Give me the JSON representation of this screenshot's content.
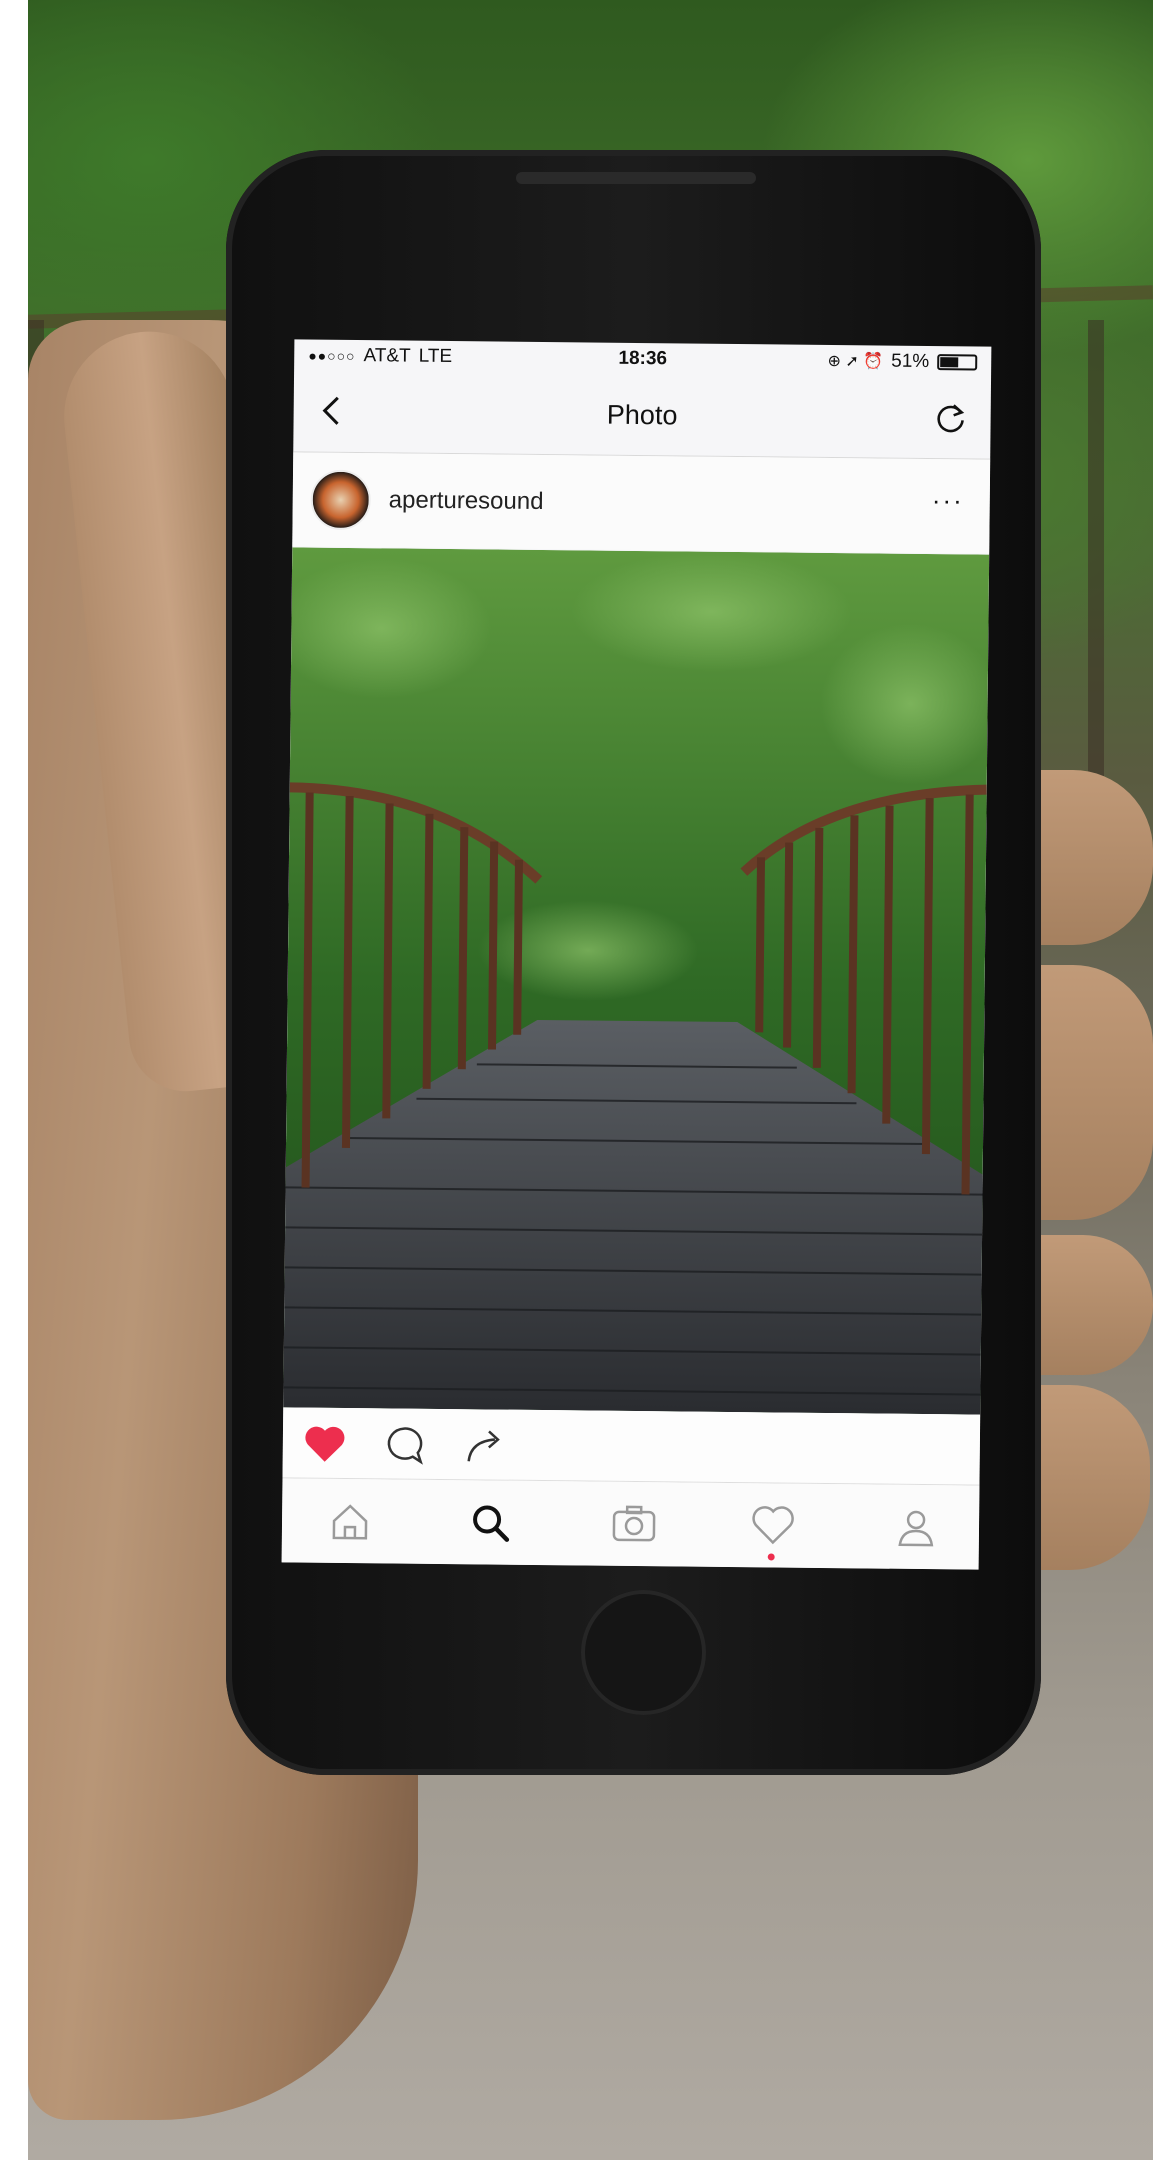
{
  "status_bar": {
    "signal": "●●○○○",
    "carrier": "AT&T",
    "network": "LTE",
    "time": "18:36",
    "indicators": "⊕ ➚ ⏰",
    "battery_percent": "51%",
    "battery_level": 0.51
  },
  "nav": {
    "title": "Photo",
    "back_icon": "chevron-left-icon",
    "refresh_icon": "refresh-icon"
  },
  "post": {
    "username": "aperturesound",
    "more_label": "···",
    "liked": true
  },
  "actions": [
    {
      "name": "like",
      "icon": "heart-filled-icon"
    },
    {
      "name": "comment",
      "icon": "speech-bubble-icon"
    },
    {
      "name": "share",
      "icon": "share-arrow-icon"
    }
  ],
  "tabs": [
    {
      "name": "home",
      "icon": "home-icon",
      "active": false
    },
    {
      "name": "search",
      "icon": "search-icon",
      "active": true
    },
    {
      "name": "camera",
      "icon": "camera-icon",
      "active": false
    },
    {
      "name": "activity",
      "icon": "heart-outline-icon",
      "active": false,
      "has_notification": true
    },
    {
      "name": "profile",
      "icon": "profile-icon",
      "active": false
    }
  ],
  "colors": {
    "like_red": "#ed2e4e",
    "notification_dot": "#ed2e4e",
    "icon_gray": "#9a9a9a",
    "icon_active": "#111111"
  }
}
